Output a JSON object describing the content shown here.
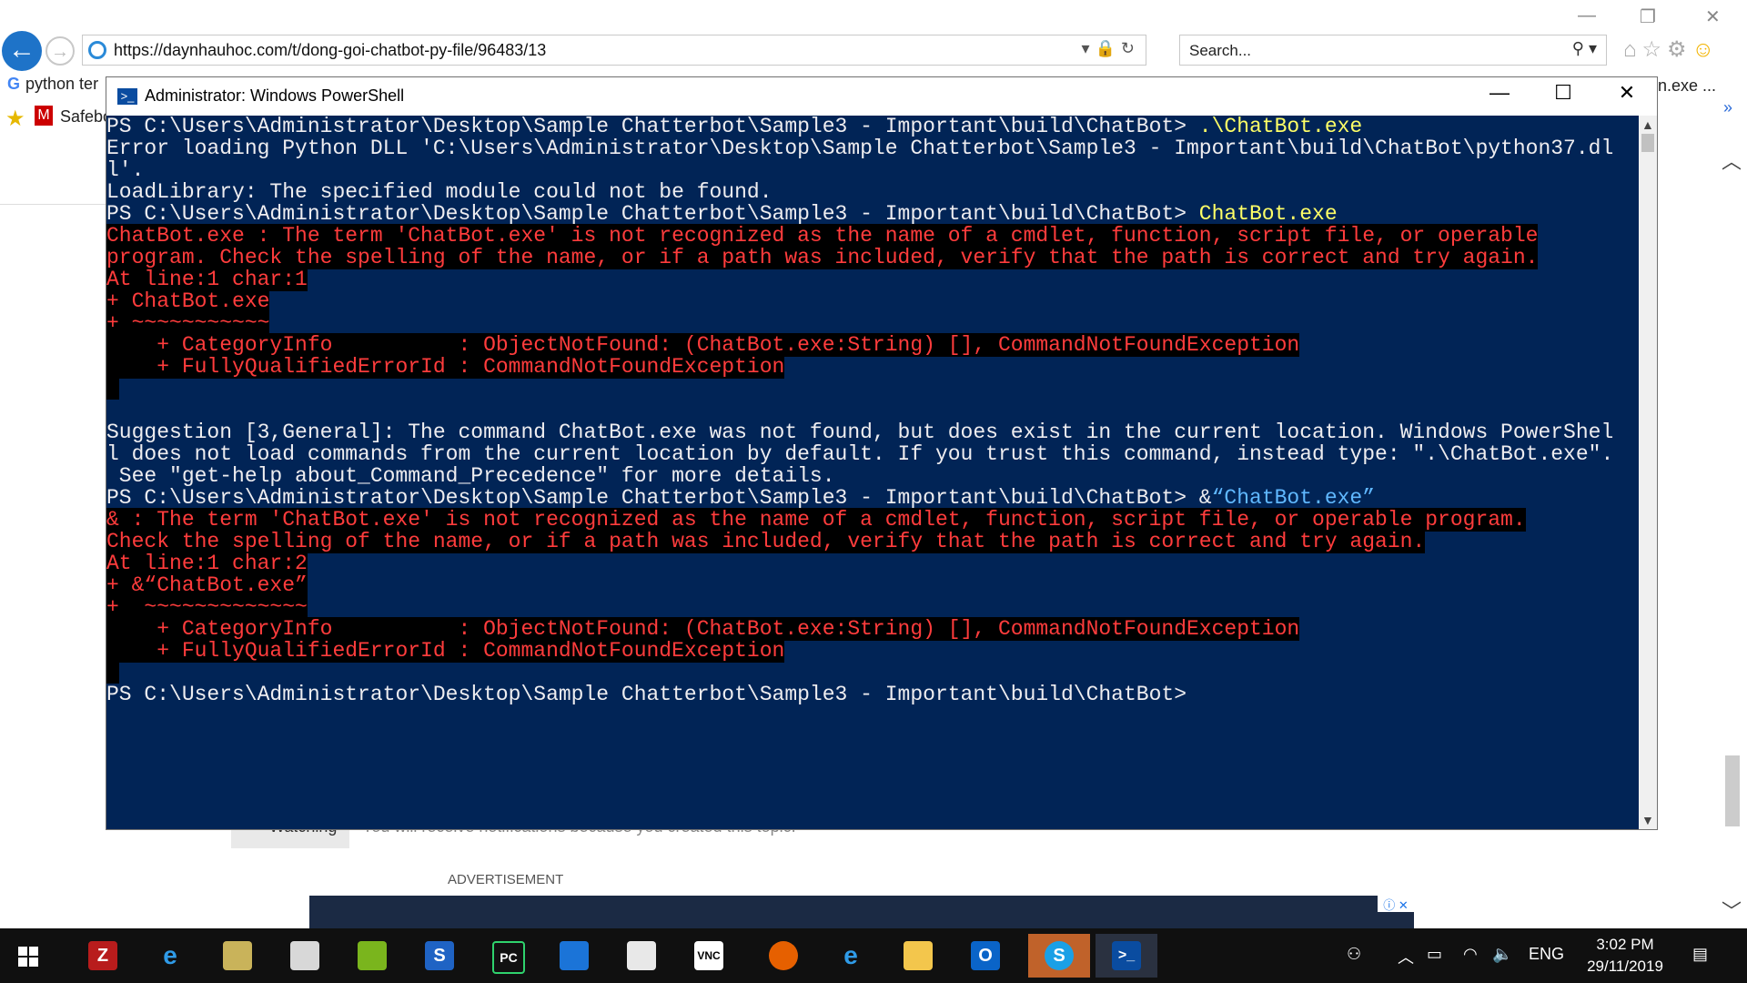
{
  "browser": {
    "url": "https://daynhauhoc.com/t/dong-goi-chatbot-py-file/96483/13",
    "search_placeholder": "Search...",
    "tab_left_label": "python ter",
    "tab_right_label": "n.exe ...",
    "favorite_label": "Safebo",
    "watching_label": "Watching",
    "watching_note": "You will receive notifications because you created this topic.",
    "advertisement_label": "ADVERTISEMENT"
  },
  "powershell": {
    "title": "Administrator: Windows PowerShell",
    "prompt": "PS C:\\Users\\Administrator\\Desktop\\Sample Chatterbot\\Sample3 - Important\\build\\ChatBot> ",
    "cmd1": ".\\ChatBot.exe",
    "out1a": "Error loading Python DLL 'C:\\Users\\Administrator\\Desktop\\Sample Chatterbot\\Sample3 - Important\\build\\ChatBot\\python37.dl",
    "out1b": "l'.",
    "out1c": "LoadLibrary: The specified module could not be found.",
    "cmd2": "ChatBot.exe",
    "err2a": "ChatBot.exe : The term 'ChatBot.exe' is not recognized as the name of a cmdlet, function, script file, or operable",
    "err2b": "program. Check the spelling of the name, or if a path was included, verify that the path is correct and try again.",
    "err2c": "At line:1 char:1",
    "err2d": "+ ChatBot.exe",
    "err2e": "+ ~~~~~~~~~~~",
    "err2f": "    + CategoryInfo          : ObjectNotFound: (ChatBot.exe:String) [], CommandNotFoundException",
    "err2g": "    + FullyQualifiedErrorId : CommandNotFoundException",
    "sug_a": "Suggestion [3,General]: The command ChatBot.exe was not found, but does exist in the current location. Windows PowerShel",
    "sug_b": "l does not load commands from the current location by default. If you trust this command, instead type: \".\\ChatBot.exe\".",
    "sug_c": " See \"get-help about_Command_Precedence\" for more details.",
    "cmd3_amp": "&",
    "cmd3": "“ChatBot.exe”",
    "err3a": "& : The term 'ChatBot.exe' is not recognized as the name of a cmdlet, function, script file, or operable program.",
    "err3b": "Check the spelling of the name, or if a path was included, verify that the path is correct and try again.",
    "err3c": "At line:1 char:2",
    "err3d": "+ &“ChatBot.exe”",
    "err3e": "+  ~~~~~~~~~~~~~",
    "err3f": "    + CategoryInfo          : ObjectNotFound: (ChatBot.exe:String) [], CommandNotFoundException",
    "err3g": "    + FullyQualifiedErrorId : CommandNotFoundException",
    "final_prompt": "PS C:\\Users\\Administrator\\Desktop\\Sample Chatterbot\\Sample3 - Important\\build\\ChatBot>"
  },
  "taskbar": {
    "apps": [
      "filezilla-icon",
      "internet-explorer-icon",
      "winrar-icon",
      "notepad-icon",
      "vmware-icon",
      "sourcetree-icon",
      "pycharm-icon",
      "bluestacks-icon",
      "pdf-editor-icon",
      "vnc-viewer-icon",
      "firefox-icon",
      "edge-icon",
      "file-explorer-icon",
      "outlook-icon",
      "skype-icon",
      "powershell-icon"
    ],
    "language": "ENG",
    "time": "3:02 PM",
    "date": "29/11/2019"
  }
}
